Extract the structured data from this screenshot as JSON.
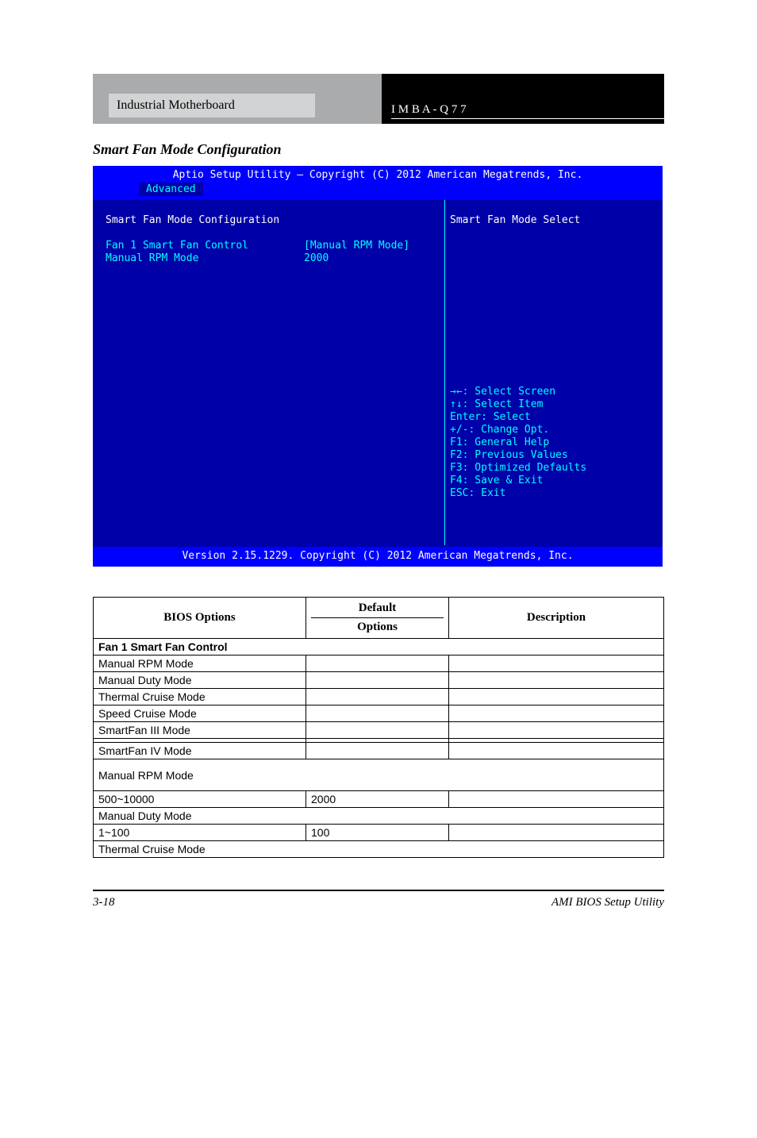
{
  "header": {
    "left_box": "Industrial Motherboard",
    "right_text": "I M B A - Q 7 7"
  },
  "section_title": "Smart Fan Mode Configuration",
  "bios": {
    "title_bar": "Aptio Setup Utility – Copyright (C) 2012 American Megatrends, Inc.",
    "tab": "Advanced",
    "panel_heading": "Smart Fan Mode Configuration",
    "row1_label": "Fan 1 Smart Fan Control",
    "row1_value": "[Manual RPM Mode]",
    "row2_label": "Manual RPM Mode",
    "row2_value": "2000",
    "side_desc": "Smart Fan  Mode Select",
    "help": {
      "h1": "→←: Select Screen",
      "h2": "↑↓: Select Item",
      "h3": "Enter: Select",
      "h4": "+/-: Change Opt.",
      "h5": "F1: General Help",
      "h6": "F2: Previous Values",
      "h7": "F3: Optimized Defaults",
      "h8": "F4: Save & Exit",
      "h9": "ESC: Exit"
    },
    "footer": "Version 2.15.1229. Copyright (C) 2012 American Megatrends, Inc."
  },
  "table": {
    "col_bios": "BIOS Options",
    "col_default": "Default",
    "col_options": "Options",
    "col_desc": "Description",
    "sub_fan": "Fan 1 Smart Fan Control",
    "rows_fan": [
      {
        "c1": "Manual RPM Mode",
        "c2": "",
        "c3": ""
      },
      {
        "c1": "Manual Duty Mode",
        "c2": "",
        "c3": ""
      },
      {
        "c1": "Thermal Cruise Mode",
        "c2": "",
        "c3": ""
      },
      {
        "c1": "Speed Cruise Mode",
        "c2": "",
        "c3": ""
      },
      {
        "c1": "SmartFan III Mode",
        "c2": "",
        "c3": ""
      },
      {
        "c1": "",
        "c2": "",
        "c3": ""
      },
      {
        "c1": "SmartFan IV Mode",
        "c2": "",
        "c3": ""
      }
    ],
    "sub_rpm": "Manual RPM Mode",
    "rows_rpm": [
      {
        "c1": "500~10000",
        "c2": "2000",
        "c3": ""
      }
    ],
    "sub_duty": "Manual Duty Mode",
    "rows_duty": [
      {
        "c1": "1~100",
        "c2": "100",
        "c3": ""
      }
    ],
    "sub_thermal": "Thermal Cruise Mode"
  },
  "page_footer": {
    "left": "3-18",
    "right": "AMI BIOS Setup Utility"
  }
}
